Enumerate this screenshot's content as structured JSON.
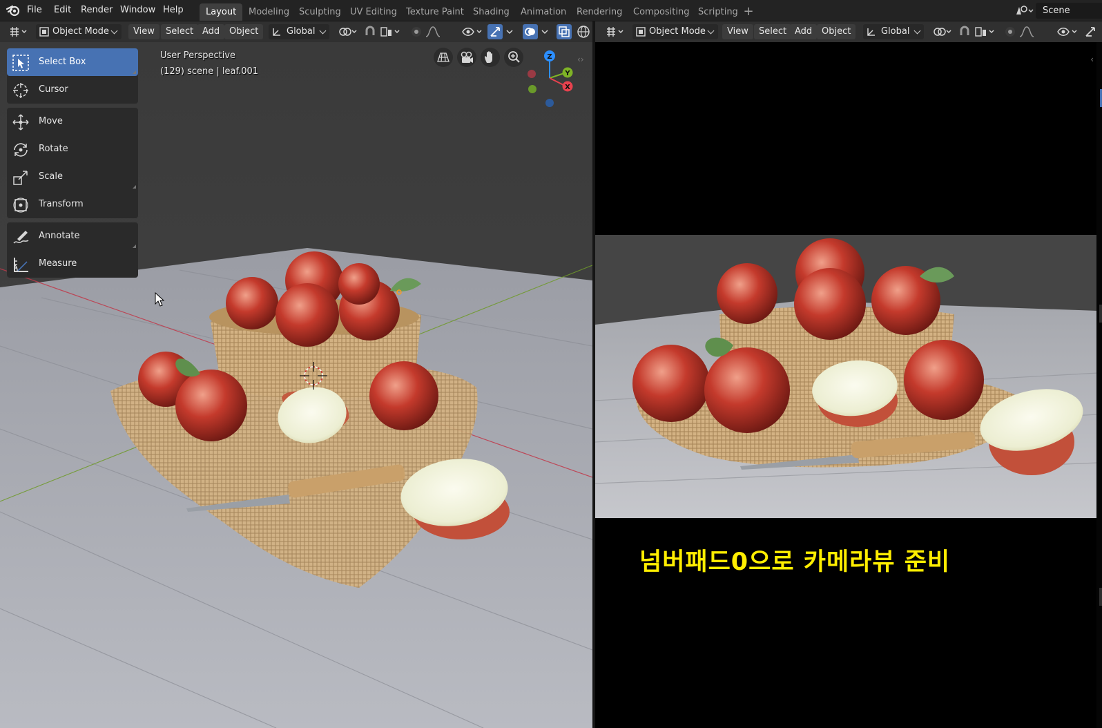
{
  "top_menu": {
    "file": "File",
    "edit": "Edit",
    "render": "Render",
    "window": "Window",
    "help": "Help"
  },
  "workspace_tabs": [
    "Layout",
    "Modeling",
    "Sculpting",
    "UV Editing",
    "Texture Paint",
    "Shading",
    "Animation",
    "Rendering",
    "Compositing",
    "Scripting"
  ],
  "active_tab": "Layout",
  "scene_name": "Scene",
  "header": {
    "mode": "Object Mode",
    "view": "View",
    "select": "Select",
    "add": "Add",
    "object": "Object",
    "orientation": "Global"
  },
  "toolbar": {
    "tools": [
      {
        "label": "Select Box",
        "icon": "select-box-icon",
        "active": true
      },
      {
        "label": "Cursor",
        "icon": "cursor-icon"
      },
      {
        "label": "Move",
        "icon": "move-icon"
      },
      {
        "label": "Rotate",
        "icon": "rotate-icon"
      },
      {
        "label": "Scale",
        "icon": "scale-icon"
      },
      {
        "label": "Transform",
        "icon": "transform-icon"
      },
      {
        "label": "Annotate",
        "icon": "annotate-icon"
      },
      {
        "label": "Measure",
        "icon": "measure-icon"
      }
    ]
  },
  "viewport": {
    "perspective": "User Perspective",
    "object_info": "(129) scene | leaf.001"
  },
  "gizmo": {
    "x": "X",
    "y": "Y",
    "z": "Z"
  },
  "caption": "넘버패드0으로 카메라뷰 준비",
  "colors": {
    "accent": "#4772b3",
    "caption": "#ffee00",
    "axis_x": "#e8424e",
    "axis_y": "#7fb326",
    "axis_z": "#2c8fff"
  }
}
